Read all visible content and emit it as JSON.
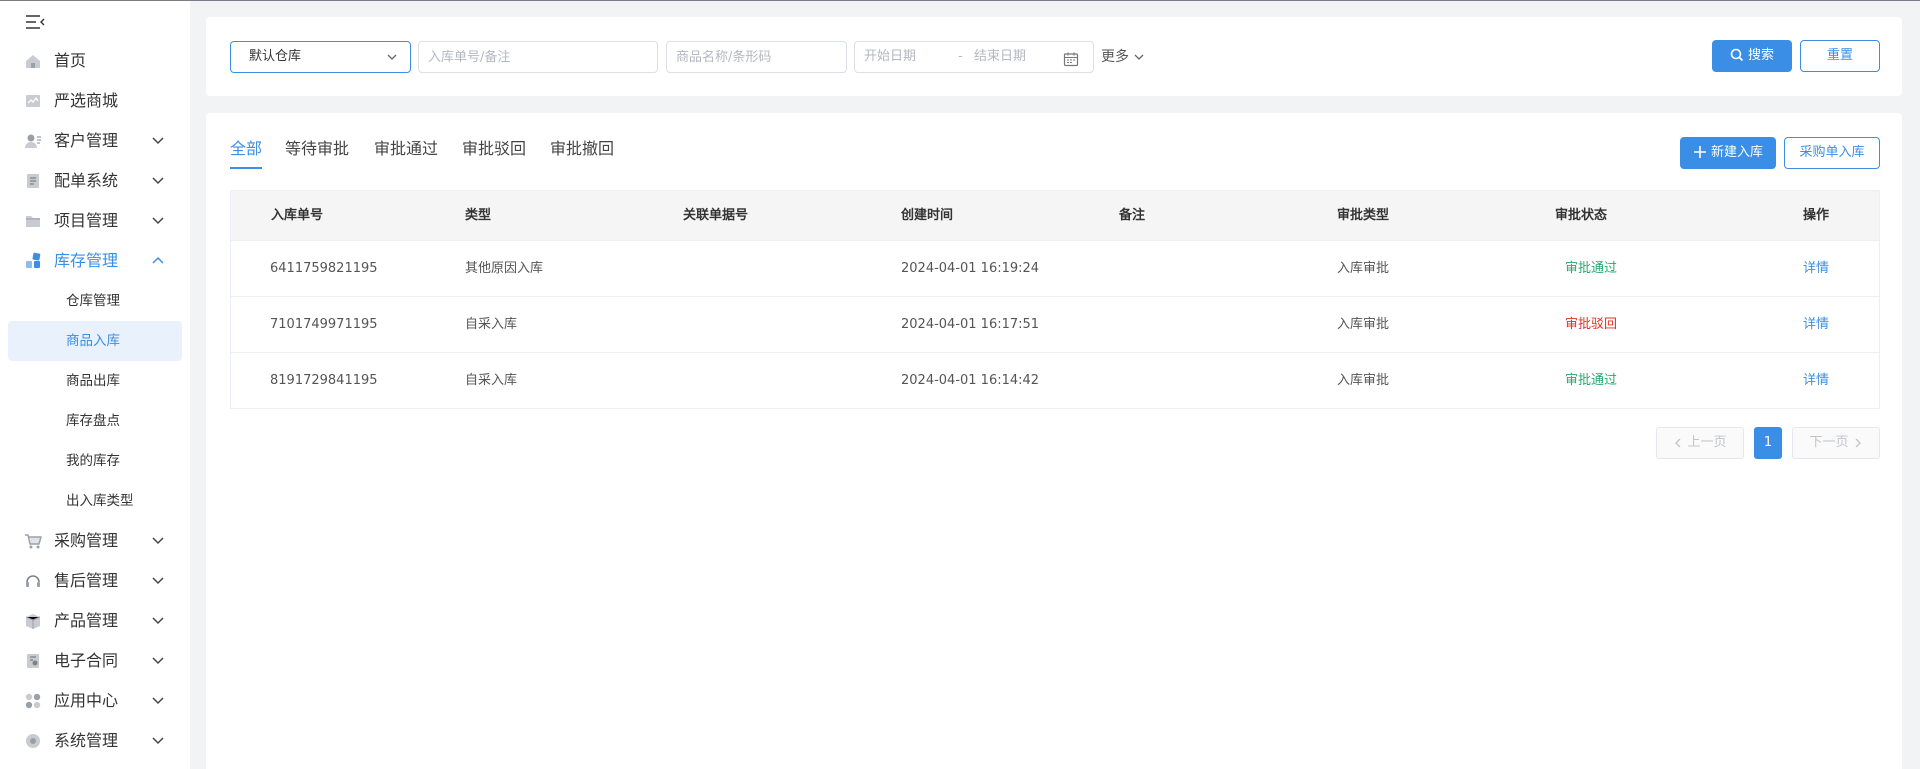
{
  "sidebar": {
    "items": [
      {
        "label": "首页",
        "icon": "home-icon"
      },
      {
        "label": "严选商城",
        "icon": "mall-icon"
      },
      {
        "label": "客户管理",
        "icon": "customer-icon"
      },
      {
        "label": "配单系统",
        "icon": "order-icon"
      },
      {
        "label": "项目管理",
        "icon": "folder-icon"
      },
      {
        "label": "库存管理",
        "icon": "inventory-icon"
      },
      {
        "label": "采购管理",
        "icon": "cart-icon"
      },
      {
        "label": "售后管理",
        "icon": "headset-icon"
      },
      {
        "label": "产品管理",
        "icon": "box-icon"
      },
      {
        "label": "电子合同",
        "icon": "contract-icon"
      },
      {
        "label": "应用中心",
        "icon": "apps-icon"
      },
      {
        "label": "系统管理",
        "icon": "settings-icon"
      }
    ],
    "inventory_sub": [
      "仓库管理",
      "商品入库",
      "商品出库",
      "库存盘点",
      "我的库存",
      "出入库类型"
    ]
  },
  "filters": {
    "warehouse_value": "默认仓库",
    "order_placeholder": "入库单号/备注",
    "product_placeholder": "商品名称/条形码",
    "start_placeholder": "开始日期",
    "date_separator": "-",
    "end_placeholder": "结束日期",
    "more_label": "更多",
    "search_label": "搜索",
    "reset_label": "重置"
  },
  "tabs": [
    "全部",
    "等待审批",
    "审批通过",
    "审批驳回",
    "审批撤回"
  ],
  "actions": {
    "new_label": "新建入库",
    "po_label": "采购单入库"
  },
  "table": {
    "headers": [
      "入库单号",
      "类型",
      "关联单据号",
      "创建时间",
      "备注",
      "审批类型",
      "审批状态",
      "操作"
    ],
    "rows": [
      {
        "id": "6411759821195",
        "type": "其他原因入库",
        "related": "",
        "created": "2024-04-01 16:19:24",
        "remark": "",
        "approval_type": "入库审批",
        "status": "审批通过",
        "status_color": "#28a870",
        "action": "详情"
      },
      {
        "id": "7101749971195",
        "type": "自采入库",
        "related": "",
        "created": "2024-04-01 16:17:51",
        "remark": "",
        "approval_type": "入库审批",
        "status": "审批驳回",
        "status_color": "#e0321f",
        "action": "详情"
      },
      {
        "id": "8191729841195",
        "type": "自采入库",
        "related": "",
        "created": "2024-04-01 16:14:42",
        "remark": "",
        "approval_type": "入库审批",
        "status": "审批通过",
        "status_color": "#28a870",
        "action": "详情"
      }
    ]
  },
  "pagination": {
    "prev_label": "上一页",
    "current_page": "1",
    "next_label": "下一页"
  },
  "colors": {
    "accent": "#3a8ee6",
    "approved": "#28a870",
    "rejected": "#e0321f"
  }
}
